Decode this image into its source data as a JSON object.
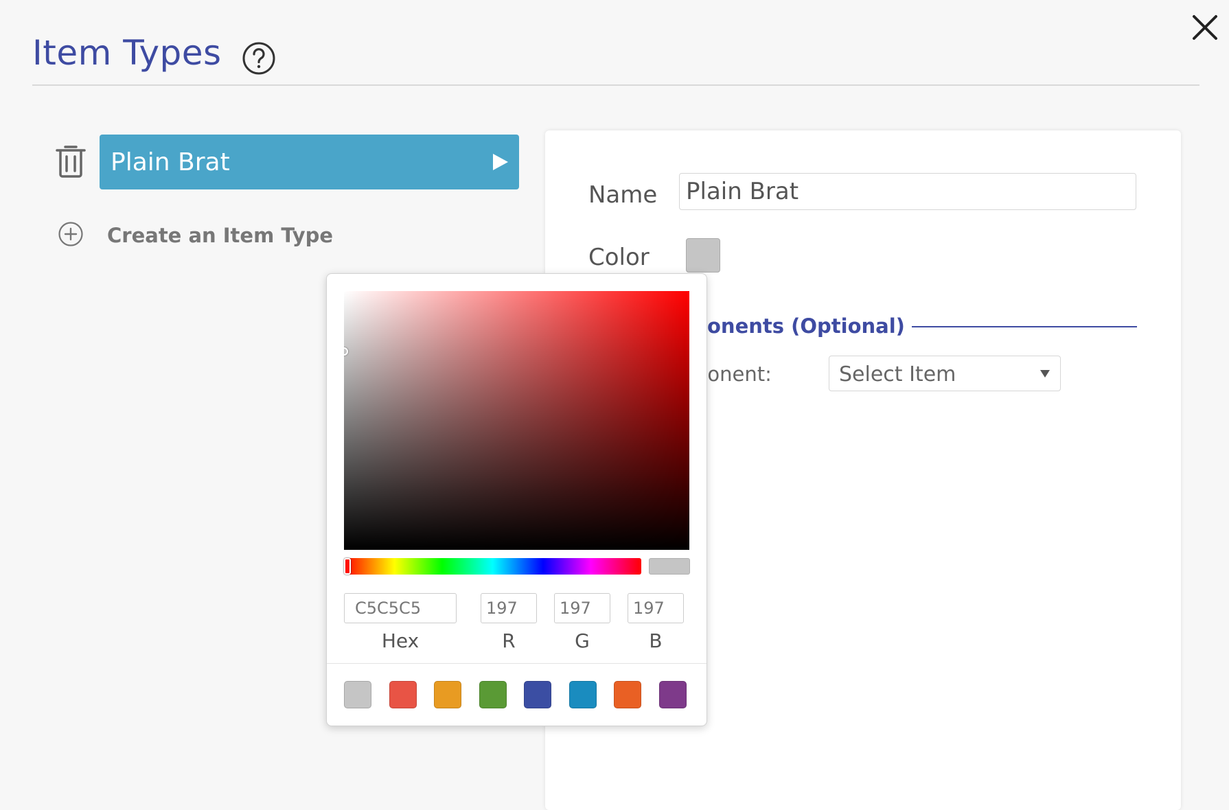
{
  "header": {
    "title": "Item Types"
  },
  "item_list": {
    "items": [
      {
        "label": "Plain Brat"
      }
    ],
    "create_label": "Create an Item Type"
  },
  "details": {
    "name_label": "Name",
    "name_value": "Plain Brat",
    "color_label": "Color",
    "color_value": "#c5c5c5",
    "components_heading": "onents (Optional)",
    "component_label": "ponent:",
    "select_label": "Select Item"
  },
  "color_picker": {
    "hue_color": "#ff0000",
    "hex_value": "C5C5C5",
    "r_value": "197",
    "g_value": "197",
    "b_value": "197",
    "hex_label": "Hex",
    "r_label": "R",
    "g_label": "G",
    "b_label": "B",
    "presets": [
      "#c5c5c5",
      "#e85445",
      "#e89b22",
      "#5a9a35",
      "#3b4ea3",
      "#1a8cbf",
      "#e96024",
      "#7e3a8a"
    ]
  },
  "colors": {
    "accent": "#3e4ba2",
    "selected_row": "#4aa5c9"
  }
}
